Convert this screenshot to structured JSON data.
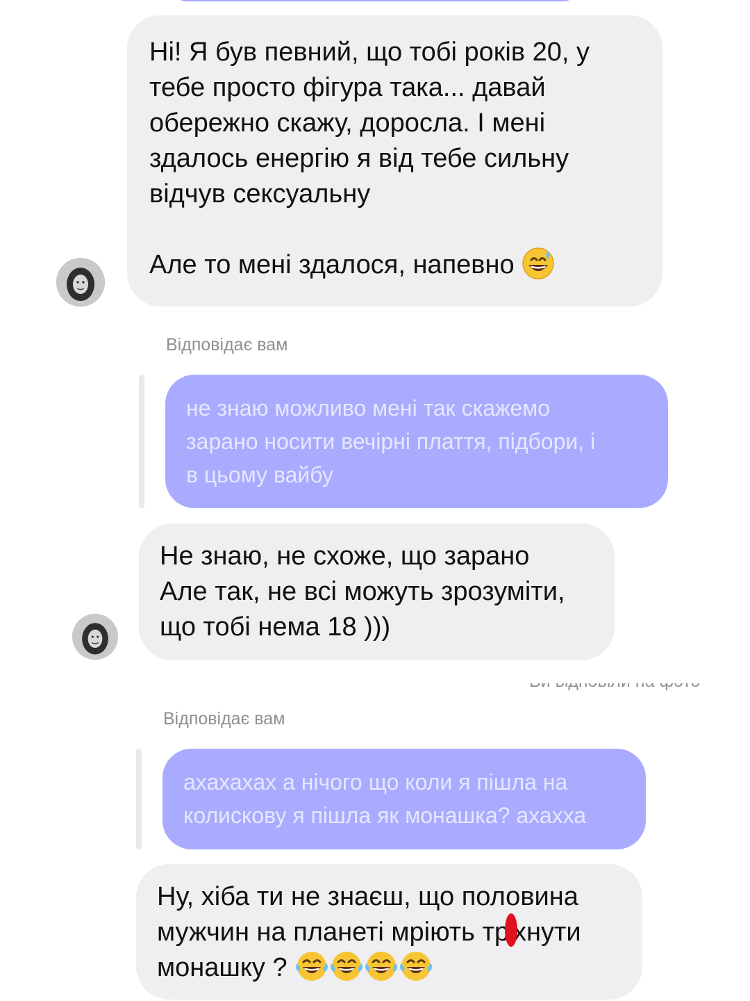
{
  "messages": {
    "msg1": {
      "lines": [
        "Ні! Я був певний, що тобі років 20, у",
        "тебе просто фігура така... давай",
        "обережно скажу, доросла. І мені",
        "здалось енергію я від тебе сильну",
        "відчув сексуальну",
        "",
        "Але то мені здалося, напевно"
      ],
      "emoji": "grinning-sweat-emoji"
    },
    "reply1": {
      "label": "Відповідає вам",
      "quoted_lines": [
        "не знаю можливо мені так скажемо",
        "зарано носити вечірні плаття, підбори, і",
        "в цьому вайбу"
      ]
    },
    "msg2": {
      "lines": [
        "Не знаю, не схоже, що зарано",
        "Але так, не всі можуть зрозуміти,",
        "що тобі нема 18 )))"
      ]
    },
    "cut_text": "Ви відповіли на фото",
    "reply2": {
      "label": "Відповідає вам",
      "quoted_lines": [
        "ахахахах а нічого що коли я пішла на",
        "колискову я пішла як монашка? ахахха"
      ]
    },
    "msg3": {
      "line1": "Ну, хіба ти не знаєш, що половина",
      "line2_before": "мужчин на планеті мріють тр",
      "line2_after": "хнути",
      "line3": "монашку ?",
      "emojis": [
        "tears-of-joy-emoji",
        "tears-of-joy-emoji",
        "tears-of-joy-emoji",
        "tears-of-joy-emoji"
      ]
    }
  },
  "colors": {
    "incoming_bubble": "#efeff1",
    "quoted_bubble": "#a9abff",
    "quoted_text": "#e6e7ff",
    "meta_text": "#8e8e93",
    "censor_mark": "#e0101e"
  }
}
